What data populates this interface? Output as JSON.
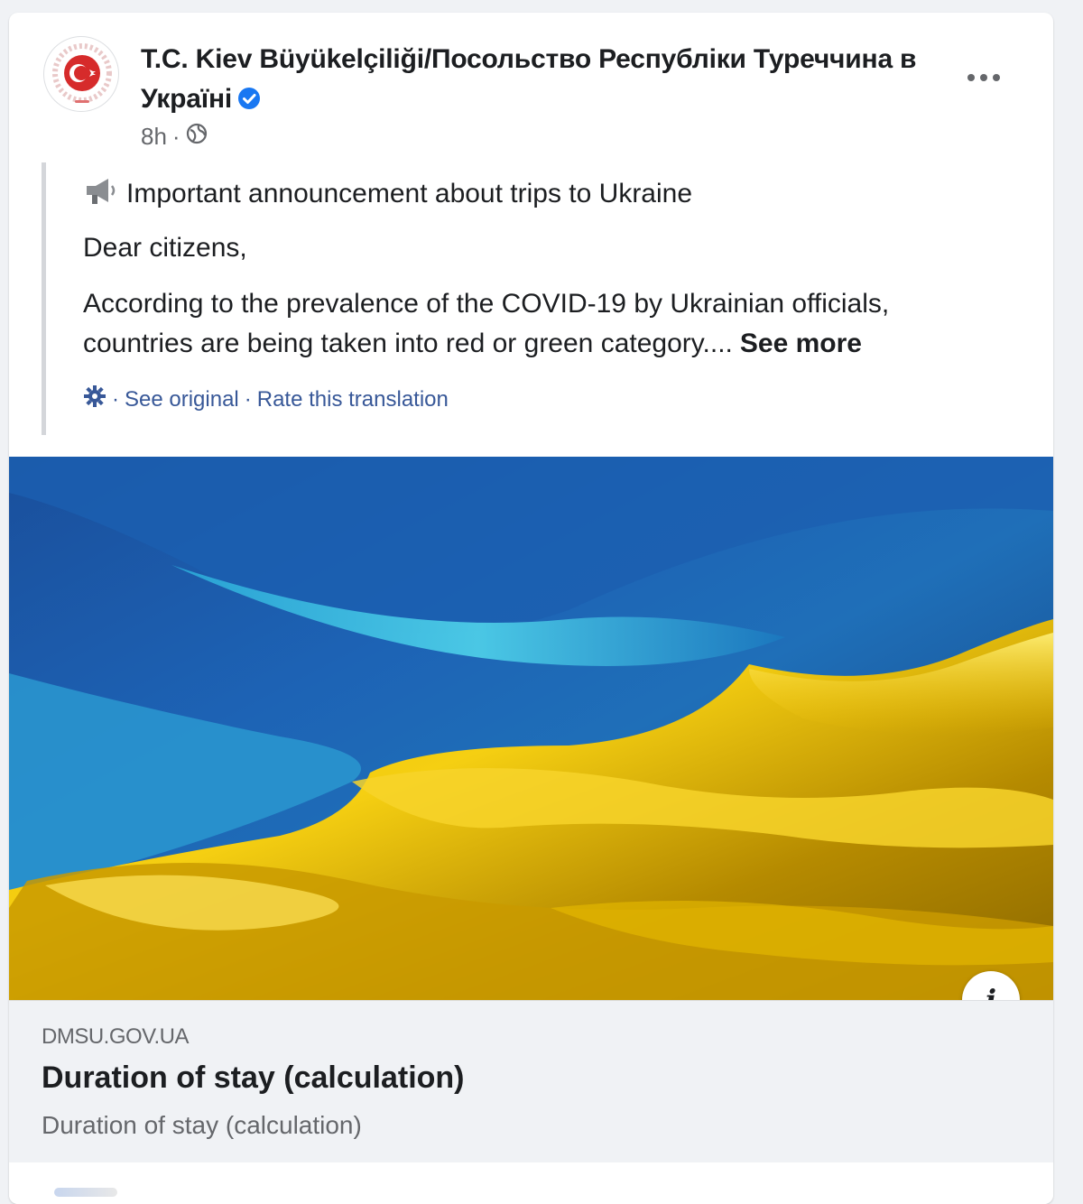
{
  "post": {
    "page_name": "T.C. Kiev Büyükelçiliği/Посольство Республіки Туреччина в Україні",
    "verified_icon": "verified-badge-icon",
    "time": "8h",
    "separator": "·",
    "audience_icon": "globe-icon",
    "more_icon": "more-options-icon",
    "announcement_icon": "megaphone-icon",
    "announcement": "Important announcement about trips to Ukraine",
    "greeting": "Dear citizens,",
    "body_line1": "According to the prevalence of the COVID-19 by Ukrainian officials,",
    "body_line2": "countries are being taken into red or green category....",
    "see_more": "See more",
    "translation": {
      "icon": "gear-icon",
      "sep1": "·",
      "see_original": "See original",
      "sep2": "·",
      "rate": "Rate this translation"
    }
  },
  "hero_image": {
    "subject": "ukraine-flag-image",
    "colors": {
      "blue": "#1f5aa8",
      "cyan": "#3fc2e0",
      "yellow": "#f2c400"
    }
  },
  "link_preview": {
    "domain": "DMSU.GOV.UA",
    "title": "Duration of stay (calculation)",
    "description": "Duration of stay (calculation)",
    "info_icon": "info-icon",
    "info_label": "i"
  },
  "colors": {
    "link_blue": "#385898",
    "verified_blue": "#1877f2",
    "secondary_text": "#65676b"
  }
}
